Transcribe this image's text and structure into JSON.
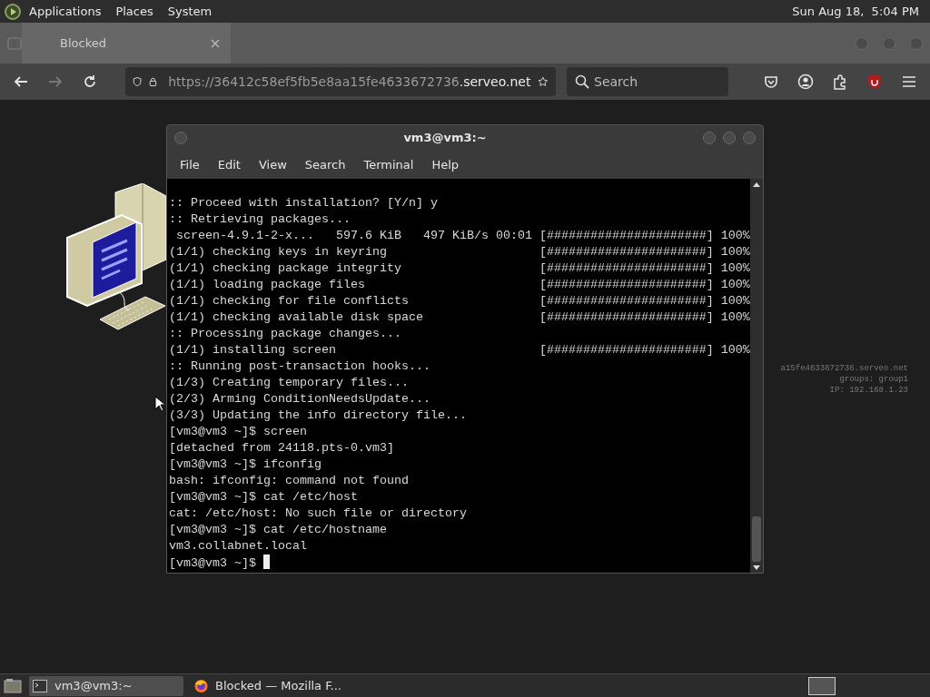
{
  "top_panel": {
    "menus": [
      "Applications",
      "Places",
      "System"
    ],
    "clock": "Sun Aug 18,  5:04 PM"
  },
  "browser": {
    "tabs": [
      {
        "label": "Blocked",
        "selected": true
      }
    ],
    "forward": {
      "disabled": true
    },
    "url": {
      "base": "https://36412c58ef5fb5e8aa15fe4633672736",
      "domain": ".serveo.net"
    },
    "search": {
      "placeholder": "Search"
    }
  },
  "desktop": {
    "info_lines": [
      "a15fe4633672736.serveo.net",
      "groups: group1",
      "IP: 192.168.1.23"
    ]
  },
  "terminal": {
    "title": "vm3@vm3:~",
    "menu": [
      "File",
      "Edit",
      "View",
      "Search",
      "Terminal",
      "Help"
    ],
    "lines": [
      {
        "text": ":: Proceed with installation? [Y/n] y"
      },
      {
        "text": ":: Retrieving packages..."
      },
      {
        "text": " screen-4.9.1-2-x...   597.6 KiB   497 KiB/s 00:01",
        "bar": "[######################]",
        "percent": "100%"
      },
      {
        "text": "(1/1) checking keys in keyring",
        "bar": "[######################]",
        "percent": "100%"
      },
      {
        "text": "(1/1) checking package integrity",
        "bar": "[######################]",
        "percent": "100%"
      },
      {
        "text": "(1/1) loading package files",
        "bar": "[######################]",
        "percent": "100%"
      },
      {
        "text": "(1/1) checking for file conflicts",
        "bar": "[######################]",
        "percent": "100%"
      },
      {
        "text": "(1/1) checking available disk space",
        "bar": "[######################]",
        "percent": "100%"
      },
      {
        "text": ":: Processing package changes..."
      },
      {
        "text": "(1/1) installing screen",
        "bar": "[######################]",
        "percent": "100%"
      },
      {
        "text": ":: Running post-transaction hooks..."
      },
      {
        "text": "(1/3) Creating temporary files..."
      },
      {
        "text": "(2/3) Arming ConditionNeedsUpdate..."
      },
      {
        "text": "(3/3) Updating the info directory file..."
      },
      {
        "text": "[vm3@vm3 ~]$ screen"
      },
      {
        "text": "[detached from 24118.pts-0.vm3]"
      },
      {
        "text": "[vm3@vm3 ~]$ ifconfig"
      },
      {
        "text": "bash: ifconfig: command not found"
      },
      {
        "text": "[vm3@vm3 ~]$ cat /etc/host"
      },
      {
        "text": "cat: /etc/host: No such file or directory"
      },
      {
        "text": "[vm3@vm3 ~]$ cat /etc/hostname"
      },
      {
        "text": "vm3.collabnet.local"
      },
      {
        "text": "[vm3@vm3 ~]$",
        "cursor": true
      }
    ]
  },
  "taskbar": {
    "tasks": [
      {
        "kind": "terminal",
        "label": "vm3@vm3:~",
        "selected": true
      },
      {
        "kind": "firefox",
        "label": "Blocked — Mozilla F...",
        "selected": false
      }
    ]
  }
}
